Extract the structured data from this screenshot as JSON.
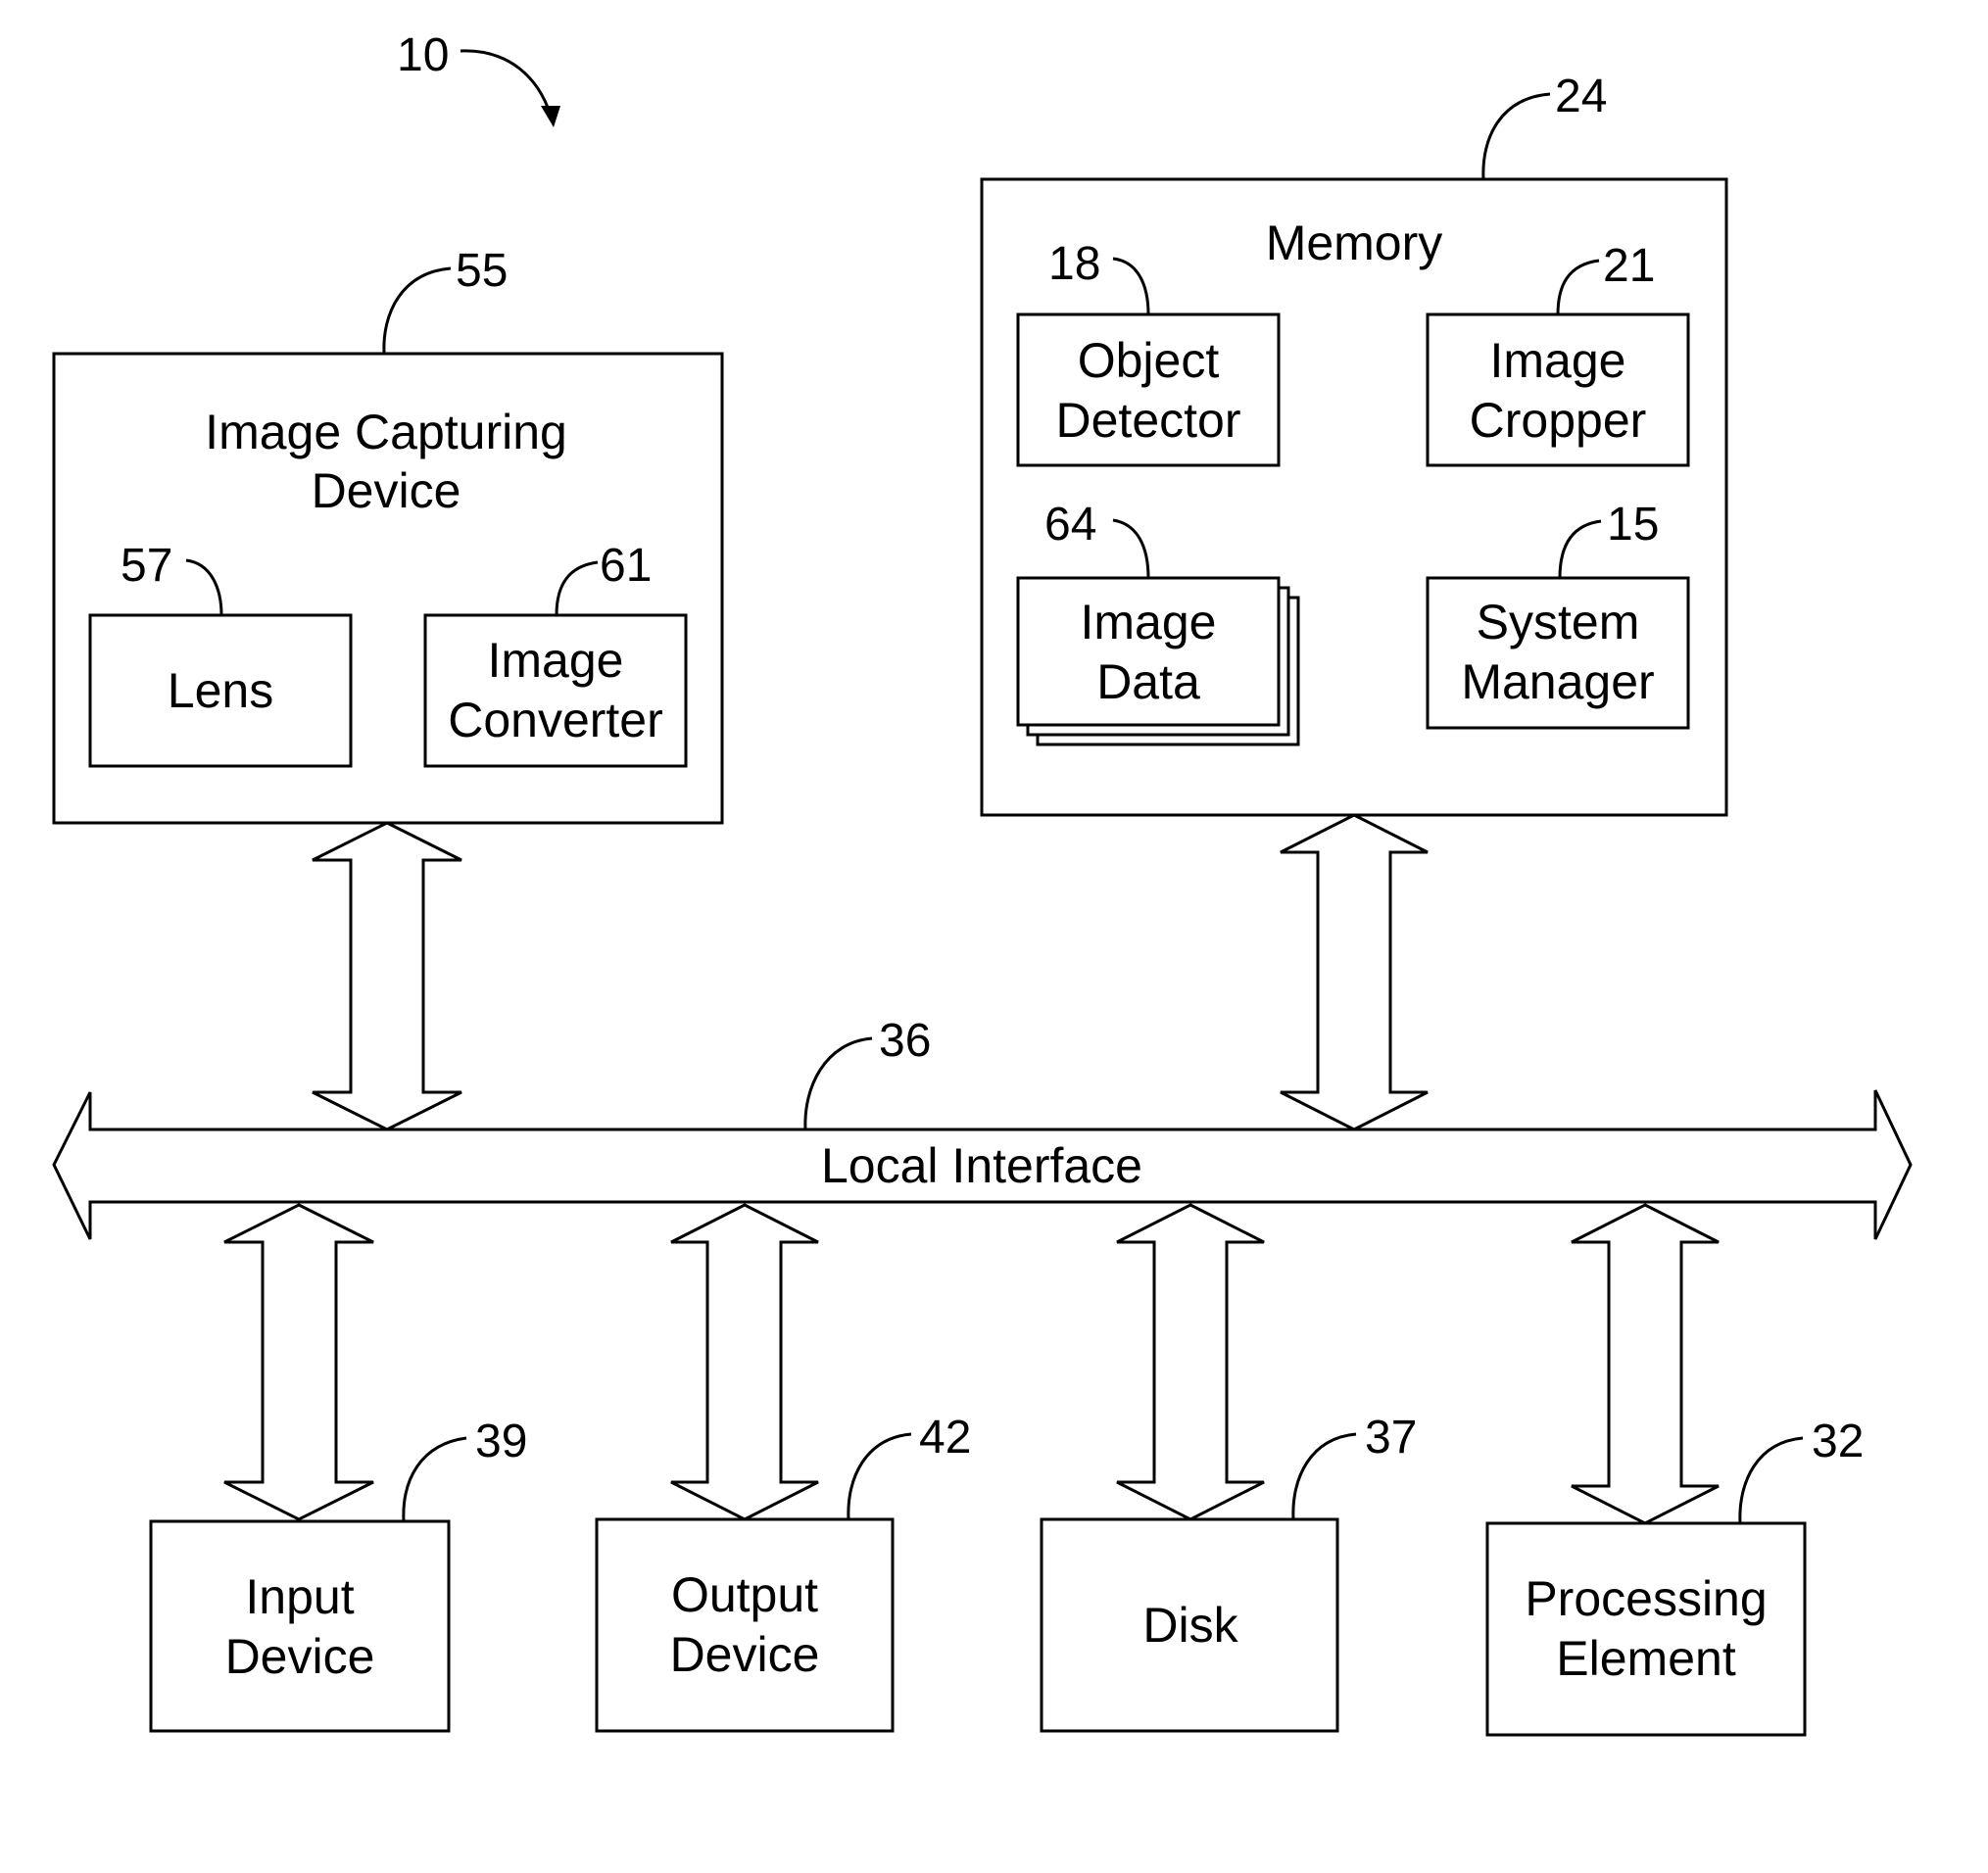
{
  "figure": {
    "ref": "10",
    "image_capturing_device": {
      "ref": "55",
      "title_line1": "Image Capturing",
      "title_line2": "Device",
      "lens": {
        "ref": "57",
        "label": "Lens"
      },
      "converter": {
        "ref": "61",
        "line1": "Image",
        "line2": "Converter"
      }
    },
    "memory": {
      "ref": "24",
      "title": "Memory",
      "object_detector": {
        "ref": "18",
        "line1": "Object",
        "line2": "Detector"
      },
      "image_cropper": {
        "ref": "21",
        "line1": "Image",
        "line2": "Cropper"
      },
      "image_data": {
        "ref": "64",
        "line1": "Image",
        "line2": "Data"
      },
      "system_manager": {
        "ref": "15",
        "line1": "System",
        "line2": "Manager"
      }
    },
    "local_interface": {
      "ref": "36",
      "label": "Local Interface"
    },
    "input_device": {
      "ref": "39",
      "line1": "Input",
      "line2": "Device"
    },
    "output_device": {
      "ref": "42",
      "line1": "Output",
      "line2": "Device"
    },
    "disk": {
      "ref": "37",
      "label": "Disk"
    },
    "processing_element": {
      "ref": "32",
      "line1": "Processing",
      "line2": "Element"
    }
  }
}
